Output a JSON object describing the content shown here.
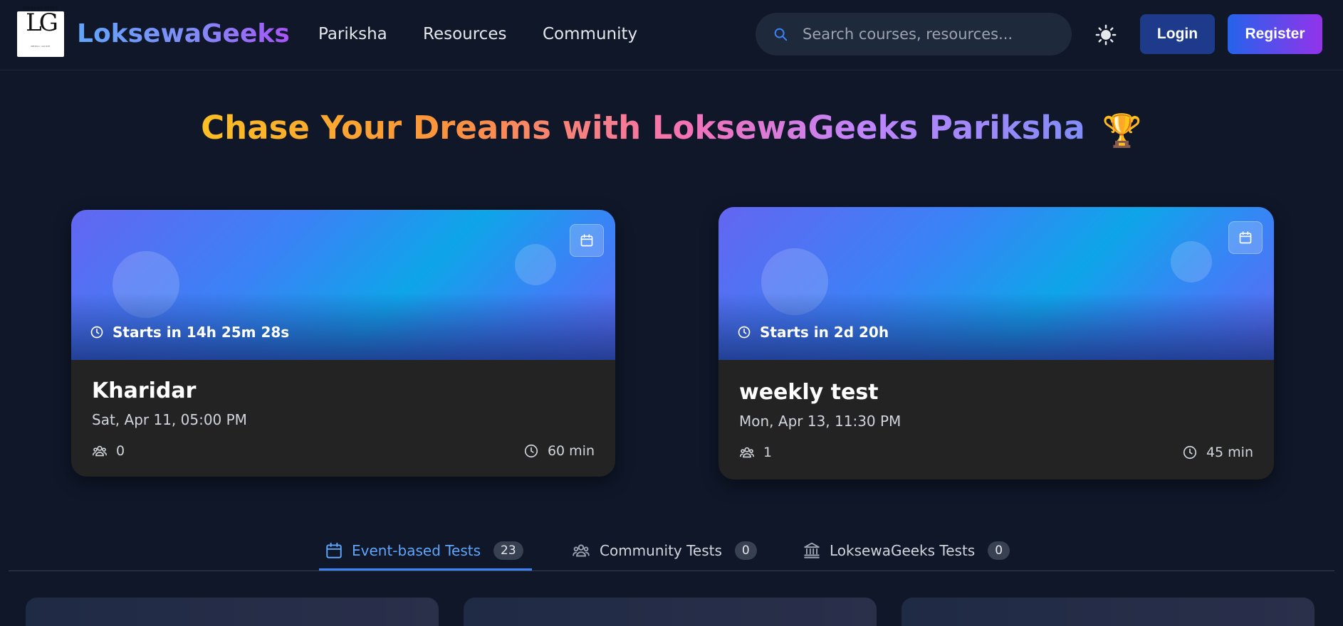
{
  "header": {
    "logo": {
      "monogram": "LG",
      "small_text": "LOKSEWA GEEKS",
      "tiny_text": "NEPALI GUIDE"
    },
    "brand": "LoksewaGeeks",
    "nav": [
      "Pariksha",
      "Resources",
      "Community"
    ],
    "search_placeholder": "Search courses, resources...",
    "login_label": "Login",
    "register_label": "Register"
  },
  "hero": {
    "title": "Chase Your Dreams with LoksewaGeeks Pariksha",
    "emoji": "🏆"
  },
  "events": [
    {
      "countdown": "Starts in 14h 25m 28s",
      "title": "Kharidar",
      "date": "Sat, Apr 11, 05:00 PM",
      "participants": "0",
      "duration": "60 min"
    },
    {
      "countdown": "Starts in 2d 20h",
      "title": "weekly test",
      "date": "Mon, Apr 13, 11:30 PM",
      "participants": "1",
      "duration": "45 min"
    }
  ],
  "tabs": [
    {
      "label": "Event-based Tests",
      "count": "23",
      "icon": "calendar-icon",
      "active": true
    },
    {
      "label": "Community Tests",
      "count": "0",
      "icon": "users-icon",
      "active": false
    },
    {
      "label": "LoksewaGeeks Tests",
      "count": "0",
      "icon": "bank-icon",
      "active": false
    }
  ],
  "colors": {
    "background": "#0f1729",
    "accent": "#3b82f6",
    "card": "#232323",
    "active_tab": "#60a5fa"
  }
}
